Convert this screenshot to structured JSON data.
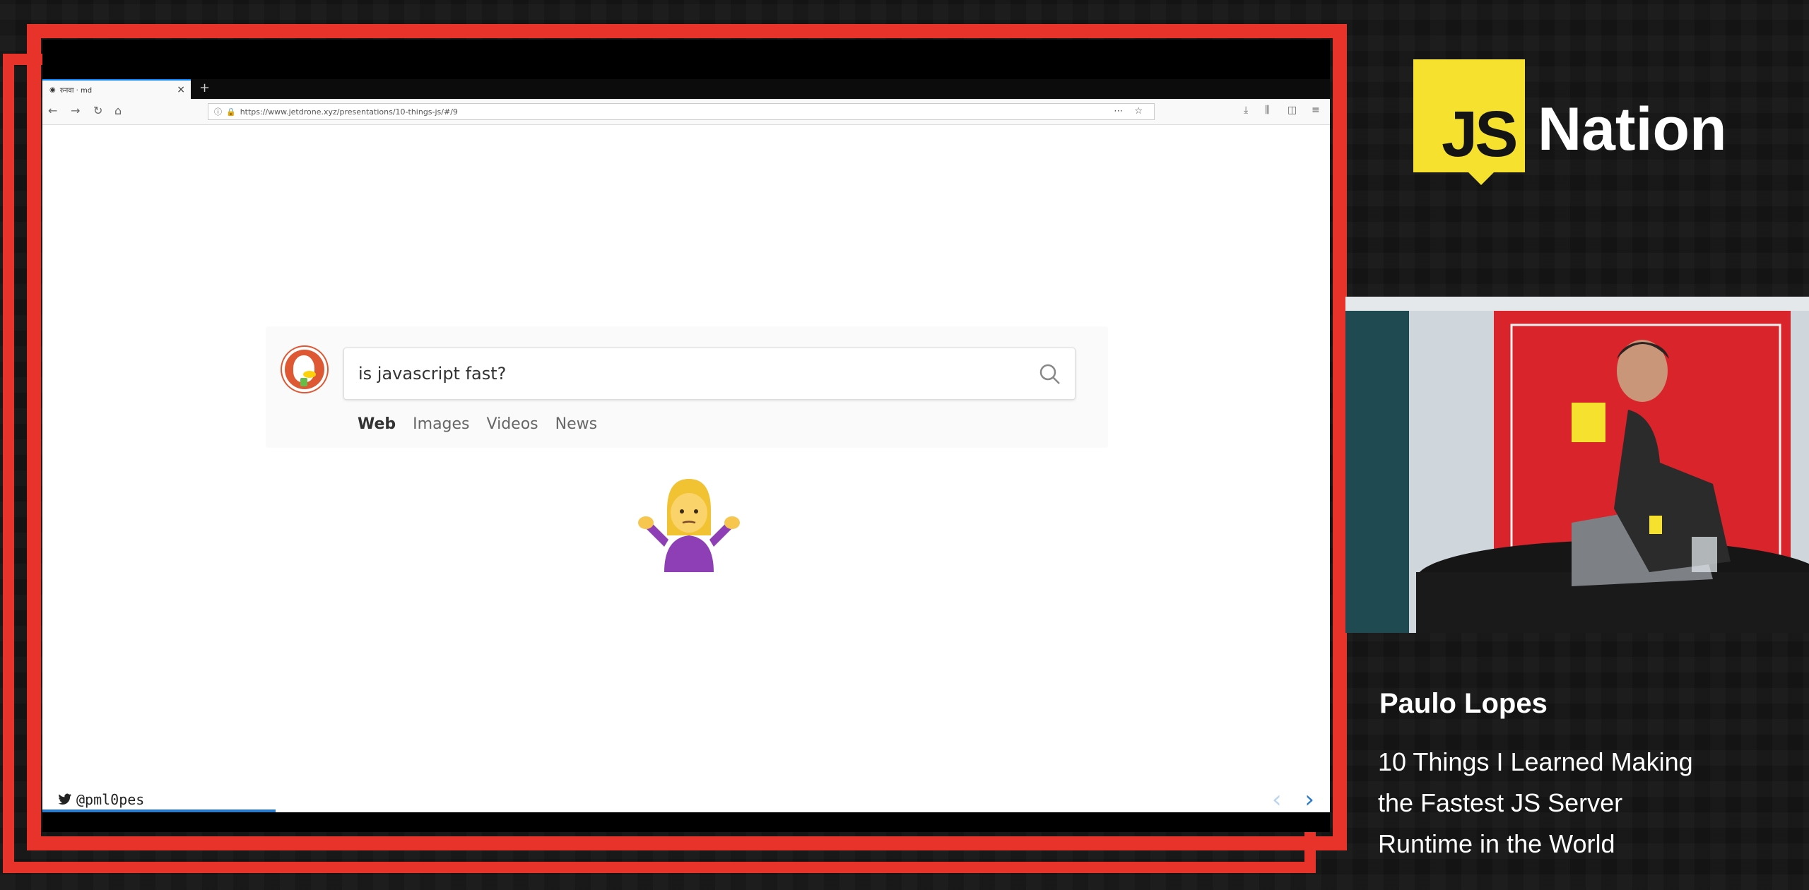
{
  "browser": {
    "tab_title": "रुनवा · md",
    "url": "https://www.jetdrone.xyz/presentations/10-things-js/#/9"
  },
  "search": {
    "query": "is javascript fast?",
    "tabs": [
      "Web",
      "Images",
      "Videos",
      "News"
    ],
    "active_tab": "Web"
  },
  "slide": {
    "twitter_handle": "@pml0pes",
    "emoji": "🤷‍♀️"
  },
  "conference": {
    "logo_js": "JS",
    "logo_name": "Nation",
    "accent_color": "#f5e12e",
    "frame_color": "#e8332a"
  },
  "speaker": {
    "name": "Paulo Lopes",
    "talk_title_lines": [
      "10 Things I Learned Making",
      "the Fastest JS Server",
      "Runtime in the World"
    ]
  }
}
